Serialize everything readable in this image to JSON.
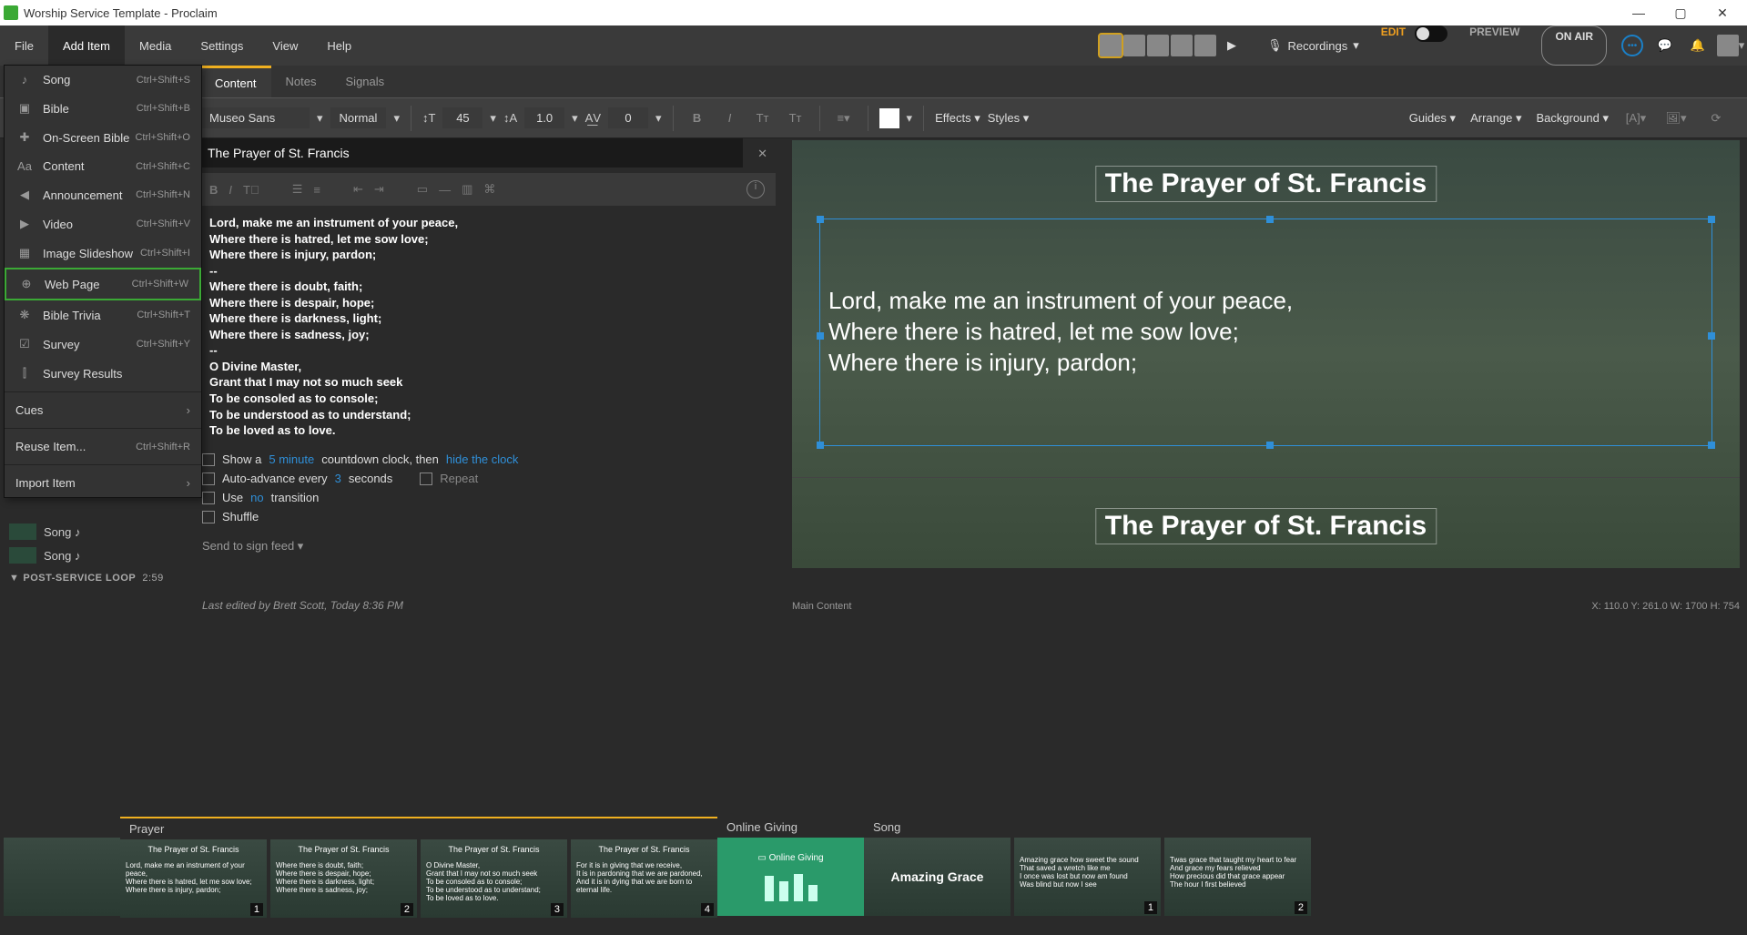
{
  "window": {
    "title": "Worship Service Template - Proclaim"
  },
  "menubar": {
    "file": "File",
    "addItem": "Add Item",
    "media": "Media",
    "settings": "Settings",
    "view": "View",
    "help": "Help",
    "recordings": "Recordings",
    "edit": "EDIT",
    "preview": "PREVIEW",
    "onair": "ON AIR"
  },
  "tabs": {
    "content": "Content",
    "notes": "Notes",
    "signals": "Signals"
  },
  "format": {
    "font": "Museo Sans",
    "weight": "Normal",
    "size": "45",
    "lineHeight": "1.0",
    "tracking": "0",
    "effects": "Effects",
    "styles": "Styles",
    "guides": "Guides",
    "arrange": "Arrange",
    "background": "Background"
  },
  "addMenu": [
    {
      "icon": "♪",
      "label": "Song",
      "sc": "Ctrl+Shift+S"
    },
    {
      "icon": "▣",
      "label": "Bible",
      "sc": "Ctrl+Shift+B"
    },
    {
      "icon": "✚",
      "label": "On-Screen Bible",
      "sc": "Ctrl+Shift+O"
    },
    {
      "icon": "Aa",
      "label": "Content",
      "sc": "Ctrl+Shift+C"
    },
    {
      "icon": "◀",
      "label": "Announcement",
      "sc": "Ctrl+Shift+N"
    },
    {
      "icon": "▶",
      "label": "Video",
      "sc": "Ctrl+Shift+V"
    },
    {
      "icon": "▦",
      "label": "Image Slideshow",
      "sc": "Ctrl+Shift+I"
    },
    {
      "icon": "⊕",
      "label": "Web Page",
      "sc": "Ctrl+Shift+W",
      "hl": true
    },
    {
      "icon": "❋",
      "label": "Bible Trivia",
      "sc": "Ctrl+Shift+T"
    },
    {
      "icon": "☑",
      "label": "Survey",
      "sc": "Ctrl+Shift+Y"
    },
    {
      "icon": "⫿",
      "label": "Survey Results",
      "sc": ""
    }
  ],
  "addMenuFooter": {
    "cues": "Cues",
    "reuse": "Reuse Item...",
    "reuseSc": "Ctrl+Shift+R",
    "import": "Import Item"
  },
  "sidebar": {
    "song": "Song  ♪",
    "postService": "POST-SERVICE LOOP",
    "postTime": "2:59"
  },
  "editor": {
    "title": "The Prayer of St. Francis",
    "lyrics": "Lord, make me an instrument of your peace,\nWhere there is hatred, let me sow love;\nWhere there is injury, pardon;\n--\nWhere there is doubt, faith;\nWhere there is despair, hope;\nWhere there is darkness, light;\nWhere there is sadness, joy;\n--\nO Divine Master,\nGrant that I may not so much seek\nTo be consoled as to console;\nTo be understood as to understand;\nTo be loved as to love.",
    "opt_showa": "Show a",
    "opt_5min": "5 minute",
    "opt_countdown": " countdown clock, then ",
    "opt_hide": "hide the clock",
    "opt_autoadv": "Auto-advance every ",
    "opt_3": "3",
    "opt_seconds": " seconds",
    "opt_repeat": "Repeat",
    "opt_use": "Use ",
    "opt_no": "no",
    "opt_trans": " transition",
    "opt_shuffle": "Shuffle",
    "signfeed": "Send to sign feed ▾",
    "editedBy": "Last edited by Brett Scott, Today 8:36 PM"
  },
  "preview": {
    "title": "The Prayer of St. Francis",
    "body": "Lord, make me an instrument of your peace,\nWhere there is hatred, let me sow love;\nWhere there is injury, pardon;",
    "status_left": "Main Content",
    "status_right": "X: 110.0  Y: 261.0    W: 1700  H: 754"
  },
  "thumbs": {
    "prayer": "Prayer",
    "slides": [
      {
        "t": "The Prayer of St. Francis",
        "b": "Lord, make me an instrument of your peace,\nWhere there is hatred, let me sow love;\nWhere there is injury, pardon;",
        "n": "1"
      },
      {
        "t": "The Prayer of St. Francis",
        "b": "Where there is doubt, faith;\nWhere there is despair, hope;\nWhere there is darkness, light;\nWhere there is sadness, joy;",
        "n": "2"
      },
      {
        "t": "The Prayer of St. Francis",
        "b": "O Divine Master,\nGrant that I may not so much seek\nTo be consoled as to console;\nTo be understood as to understand;\nTo be loved as to love.",
        "n": "3"
      },
      {
        "t": "The Prayer of St. Francis",
        "b": "For it is in giving that we receive,\nIt is in pardoning that we are pardoned,\nAnd it is in dying that we are born to eternal life.",
        "n": "4"
      }
    ],
    "giving": "Online Giving",
    "givingLabel": "Online Giving",
    "song": "Song",
    "songTitle": "Amazing Grace",
    "songSlides": [
      {
        "b": "Amazing grace how sweet the sound\nThat saved a wretch like me\nI once was lost but now am found\nWas blind but now I see",
        "n": "1"
      },
      {
        "b": "Twas grace that taught my heart to fear\nAnd grace my fears relieved\nHow precious did that grace appear\nThe hour I first believed",
        "n": "2"
      }
    ]
  }
}
